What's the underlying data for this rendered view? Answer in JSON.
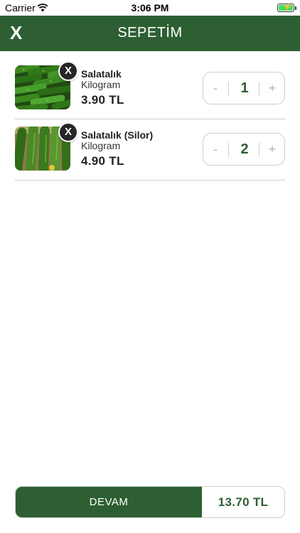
{
  "status_bar": {
    "carrier": "Carrier",
    "time": "3:06 PM",
    "battery_icon": "battery-charging-icon",
    "wifi_icon": "wifi-icon"
  },
  "header": {
    "close_label": "X",
    "title": "SEPETİM",
    "background": "#2d5f32"
  },
  "cart": {
    "items": [
      {
        "name": "Salatalık",
        "unit": "Kilogram",
        "price": "3.90 TL",
        "quantity": "1",
        "remove_label": "X",
        "minus_label": "-",
        "plus_label": "+"
      },
      {
        "name": "Salatalık (Silor)",
        "unit": "Kilogram",
        "price": "4.90 TL",
        "quantity": "2",
        "remove_label": "X",
        "minus_label": "-",
        "plus_label": "+"
      }
    ]
  },
  "footer": {
    "continue_label": "DEVAM",
    "total": "13.70 TL"
  },
  "colors": {
    "primary": "#2d5f32",
    "border": "#cfcfcf",
    "muted": "#b5b5b5"
  }
}
